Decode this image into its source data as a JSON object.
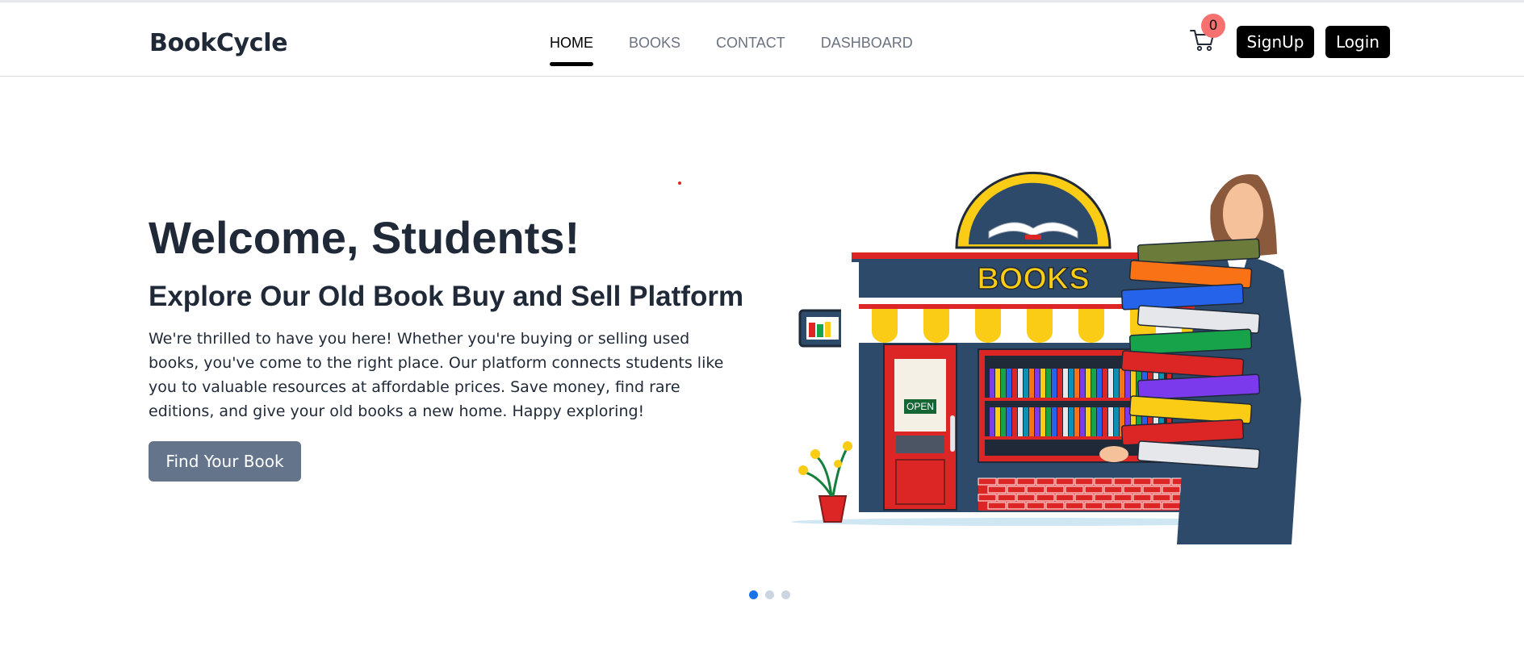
{
  "brand": {
    "name": "BookCycle"
  },
  "nav": {
    "items": [
      {
        "label": "HOME",
        "active": true
      },
      {
        "label": "BOOKS",
        "active": false
      },
      {
        "label": "CONTACT",
        "active": false
      },
      {
        "label": "DASHBOARD",
        "active": false
      }
    ]
  },
  "header": {
    "cart_icon": "shopping-cart-icon",
    "cart_count": "0",
    "signup_label": "SignUp",
    "login_label": "Login"
  },
  "hero": {
    "title": "Welcome, Students!",
    "subtitle": "Explore Our Old Book Buy and Sell Platform",
    "body": "We're thrilled to have you here! Whether you're buying or selling used books, you've come to the right place. Our platform connects students like you to valuable resources at affordable prices. Save money, find rare editions, and give your old books a new home. Happy exploring!",
    "cta_label": "Find Your Book",
    "illustration": {
      "sign_text": "BOOKS",
      "door_sign": "OPEN"
    }
  },
  "carousel": {
    "slide_count": 3,
    "active_index": 0
  },
  "colors": {
    "primary_text": "#1f2937",
    "nav_muted": "#6b7280",
    "button_dark": "#000000",
    "cta_bg": "#64748b",
    "badge_bg": "#f87171",
    "dot_active": "#1a73e8",
    "dot_inactive": "#cbd5e1"
  }
}
